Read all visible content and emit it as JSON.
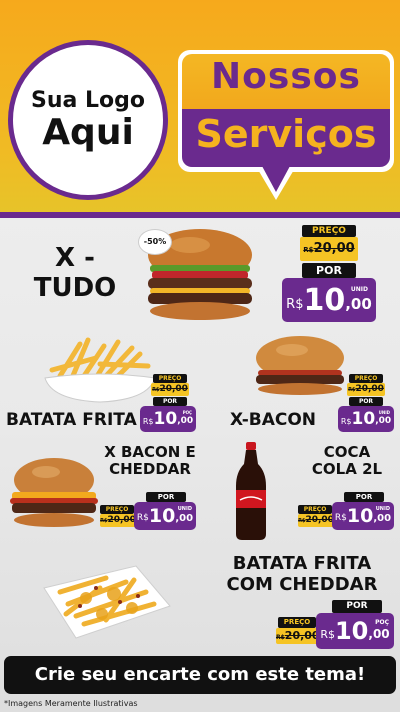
{
  "logo": {
    "line1": "Sua Logo",
    "line2": "Aqui"
  },
  "banner": {
    "line1": "Nossos",
    "line2": "Serviços"
  },
  "badge": "-50%",
  "products": [
    {
      "name_line1": "X -",
      "name_line2": "TUDO",
      "preco_label": "PREÇO",
      "old_currency": "R$",
      "old_price": "20,00",
      "por_label": "POR",
      "currency": "R$",
      "price_int": "10",
      "price_dec": ",00",
      "unit": "UNID"
    },
    {
      "name_line1": "BATATA FRITA",
      "name_line2": "",
      "preco_label": "PREÇO",
      "old_currency": "R$",
      "old_price": "20,00",
      "por_label": "POR",
      "currency": "R$",
      "price_int": "10",
      "price_dec": ",00",
      "unit": "POÇ"
    },
    {
      "name_line1": "X-BACON",
      "name_line2": "",
      "preco_label": "PREÇO",
      "old_currency": "R$",
      "old_price": "20,00",
      "por_label": "POR",
      "currency": "R$",
      "price_int": "10",
      "price_dec": ",00",
      "unit": "UNID"
    },
    {
      "name_line1": "X BACON E",
      "name_line2": "CHEDDAR",
      "preco_label": "PREÇO",
      "old_currency": "R$",
      "old_price": "20,00",
      "por_label": "POR",
      "currency": "R$",
      "price_int": "10",
      "price_dec": ",00",
      "unit": "UNID"
    },
    {
      "name_line1": "COCA",
      "name_line2": "COLA 2L",
      "preco_label": "PREÇO",
      "old_currency": "R$",
      "old_price": "20,00",
      "por_label": "POR",
      "currency": "R$",
      "price_int": "10",
      "price_dec": ",00",
      "unit": "UNID"
    },
    {
      "name_line1": "BATATA FRITA",
      "name_line2": "COM CHEDDAR",
      "preco_label": "PREÇO",
      "old_currency": "R$",
      "old_price": "20,00",
      "por_label": "POR",
      "currency": "R$",
      "price_int": "10",
      "price_dec": ",00",
      "unit": "POÇ"
    }
  ],
  "footer": {
    "cta": "Crie seu encarte com este tema!",
    "note": "*Imagens Meramente Ilustrativas"
  },
  "colors": {
    "purple": "#6a2a8e",
    "yellow": "#f5c424",
    "orange": "#f6a91c",
    "black": "#111111"
  }
}
